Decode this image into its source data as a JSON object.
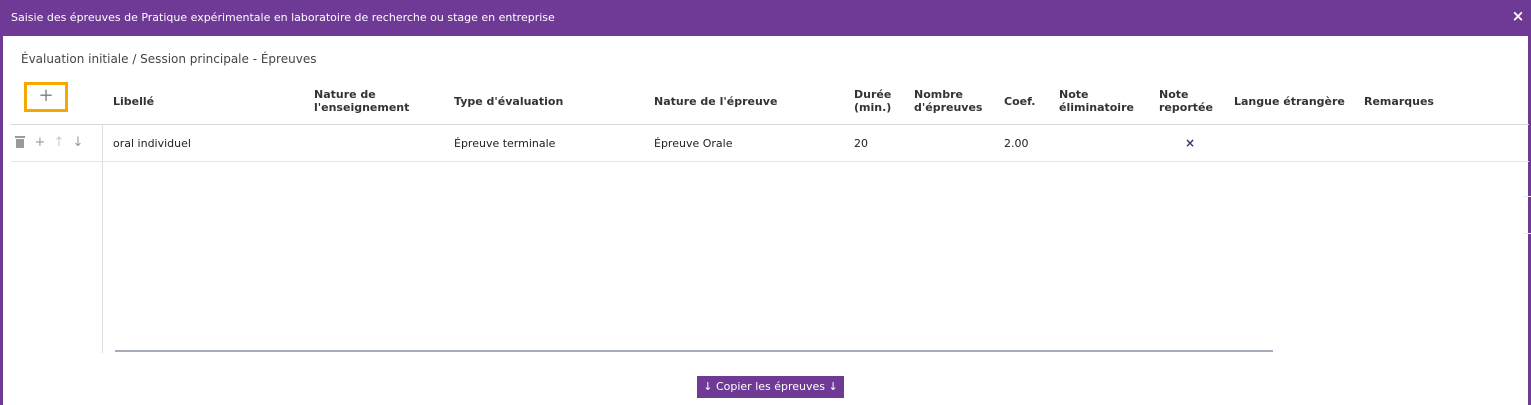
{
  "window": {
    "title": "Saisie des épreuves de Pratique expérimentale en laboratoire de recherche ou stage en entreprise",
    "close_icon": "close-icon",
    "accent_color": "#6f3a96",
    "highlight_color": "#f5a800"
  },
  "breadcrumb": "Évaluation initiale / Session principale - Épreuves",
  "toolbar": {
    "add_label": "+",
    "add_icon": "plus-icon"
  },
  "table": {
    "headers": [
      {
        "key": "libelle",
        "line1": "Libellé",
        "line2": ""
      },
      {
        "key": "nature_enseignement",
        "line1": "Nature de",
        "line2": "l'enseignement"
      },
      {
        "key": "type_evaluation",
        "line1": "Type d'évaluation",
        "line2": ""
      },
      {
        "key": "nature_epreuve",
        "line1": "Nature de l'épreuve",
        "line2": ""
      },
      {
        "key": "duree",
        "line1": "Durée",
        "line2": "(min.)"
      },
      {
        "key": "nombre_epreuves",
        "line1": "Nombre",
        "line2": "d'épreuves"
      },
      {
        "key": "coef",
        "line1": "Coef.",
        "line2": ""
      },
      {
        "key": "note_eliminatoire",
        "line1": "Note",
        "line2": "éliminatoire"
      },
      {
        "key": "note_reportee",
        "line1": "Note",
        "line2": "reportée"
      },
      {
        "key": "langue_etrangere",
        "line1": "Langue étrangère",
        "line2": ""
      },
      {
        "key": "remarques",
        "line1": "Remarques",
        "line2": ""
      }
    ],
    "rows": [
      {
        "libelle": "oral individuel",
        "nature_enseignement": "",
        "type_evaluation": "Épreuve terminale",
        "nature_epreuve": "Épreuve Orale",
        "duree": "20",
        "nombre_epreuves": "",
        "coef": "2.00",
        "note_eliminatoire": "",
        "note_reportee": "×",
        "langue_etrangere": "",
        "remarques": "",
        "actions": {
          "delete_icon": "trash-icon",
          "add_label": "+",
          "up_label": "↑",
          "down_label": "↓"
        }
      }
    ]
  },
  "footer": {
    "copy_button_label": "↓ Copier les épreuves ↓"
  }
}
